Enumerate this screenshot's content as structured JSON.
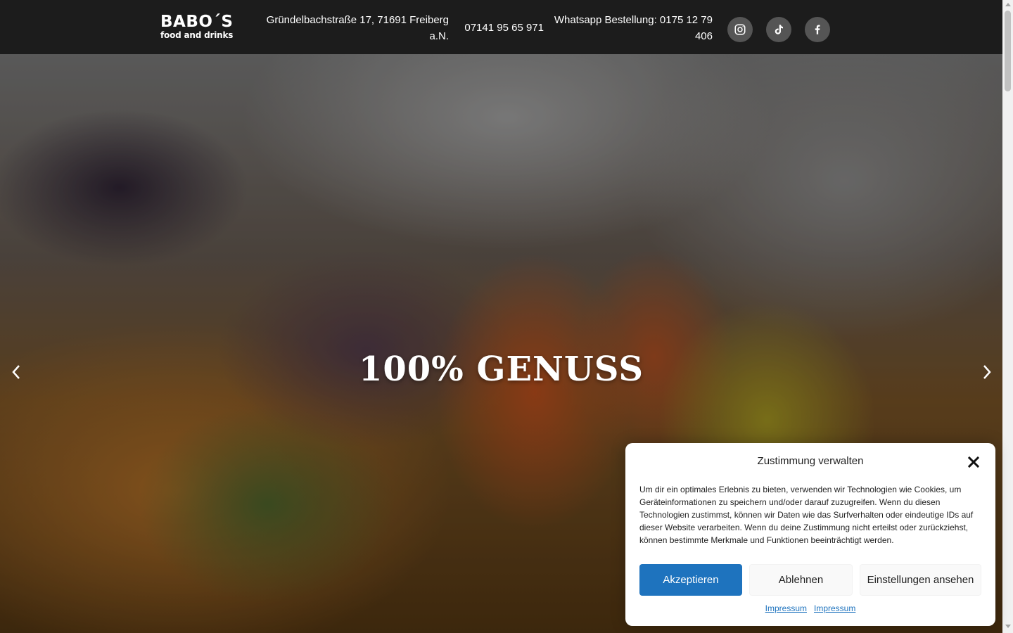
{
  "header": {
    "logo_main": "BABO´S",
    "logo_sub": "food and drinks",
    "address": "Gründelbachstraße 17, 71691 Freiberg a.N.",
    "phone": "07141 95 65 971",
    "whatsapp": "Whatsapp Bestellung: 0175 12 79 406",
    "social": [
      "instagram-icon",
      "tiktok-icon",
      "facebook-icon"
    ]
  },
  "hero": {
    "title": "100% GENUSS"
  },
  "cookie": {
    "title": "Zustimmung verwalten",
    "text": "Um dir ein optimales Erlebnis zu bieten, verwenden wir Technologien wie Cookies, um Geräteinformationen zu speichern und/oder darauf zuzugreifen. Wenn du diesen Technologien zustimmst, können wir Daten wie das Surfverhalten oder eindeutige IDs auf dieser Website verarbeiten. Wenn du deine Zustimmung nicht erteilst oder zurückziehst, können bestimmte Merkmale und Funktionen beeinträchtigt werden.",
    "accept": "Akzeptieren",
    "deny": "Ablehnen",
    "preferences": "Einstellungen ansehen",
    "links": [
      "Impressum",
      "Impressum"
    ]
  },
  "colors": {
    "header_bg": "#1c1c1c",
    "accent": "#1e73be",
    "social_bg": "#555555"
  }
}
